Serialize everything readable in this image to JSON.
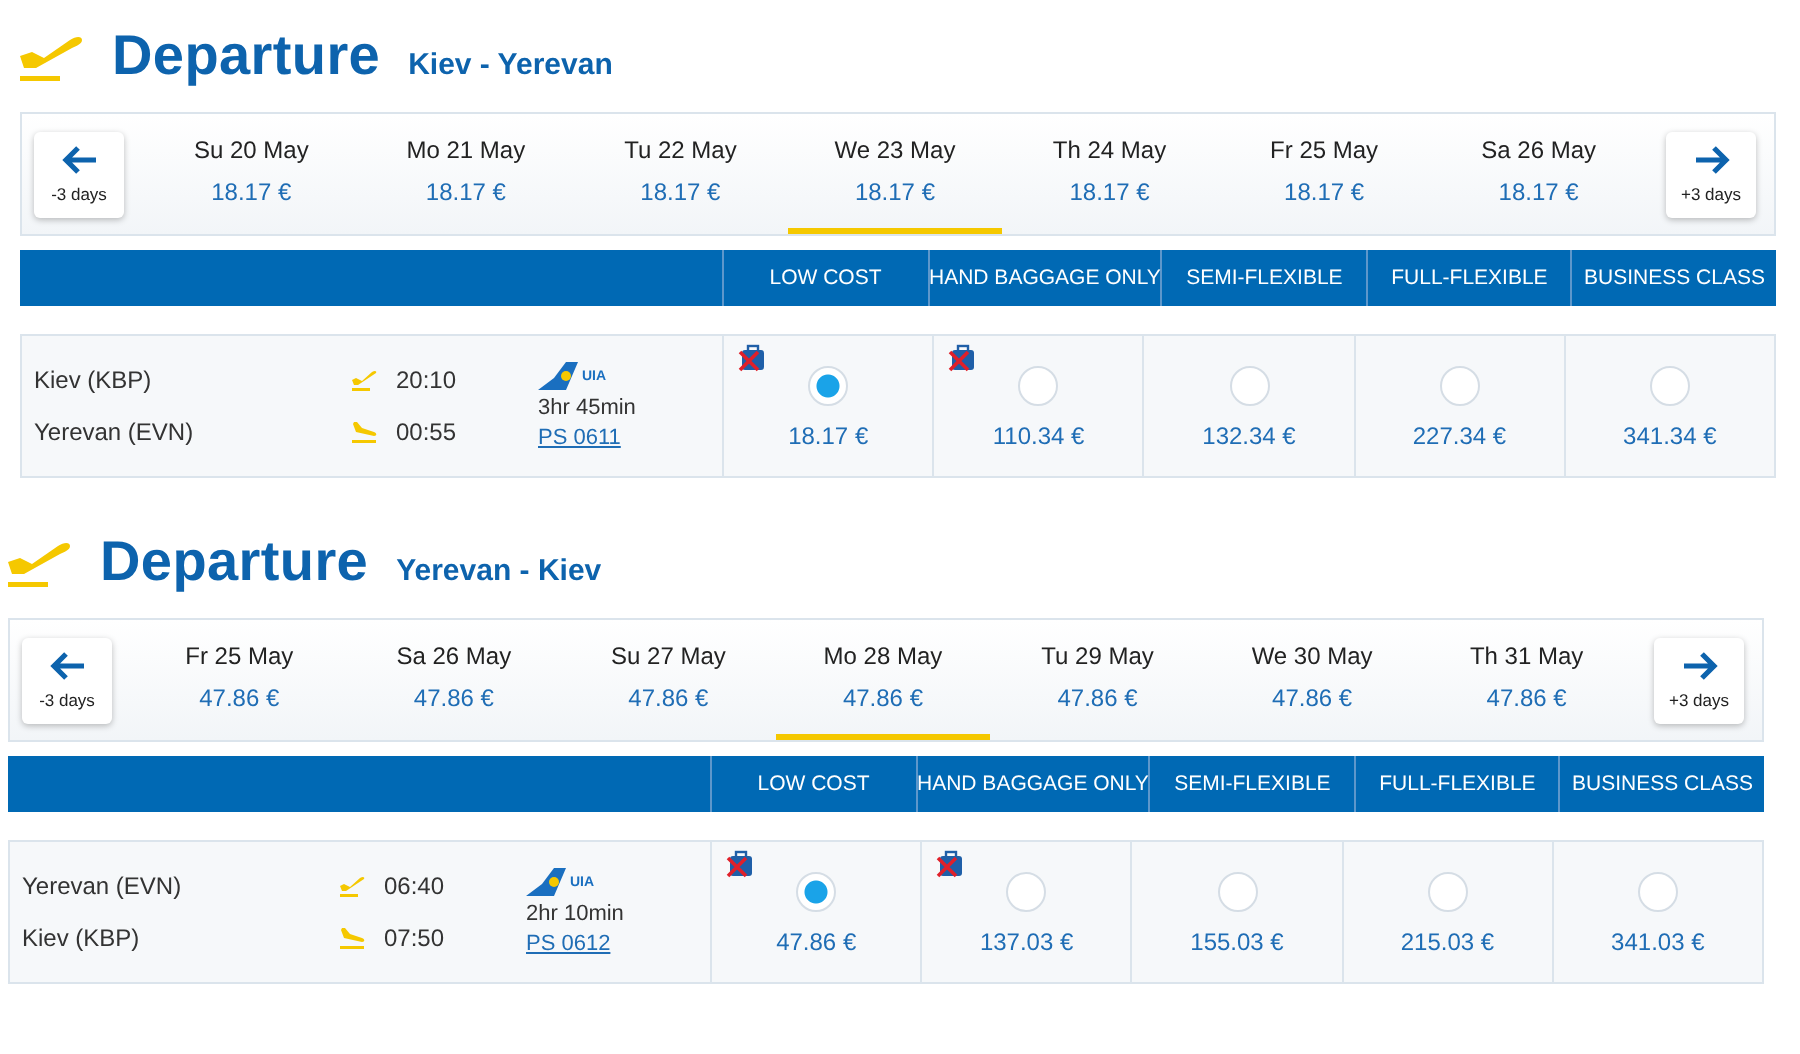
{
  "sections": [
    {
      "title": "Departure",
      "route": "Kiev - Yerevan",
      "prev": "-3 days",
      "next": "+3 days",
      "dates": [
        {
          "label": "Su 20 May",
          "price": "18.17 €",
          "selected": false
        },
        {
          "label": "Mo 21 May",
          "price": "18.17 €",
          "selected": false
        },
        {
          "label": "Tu 22 May",
          "price": "18.17 €",
          "selected": false
        },
        {
          "label": "We 23 May",
          "price": "18.17 €",
          "selected": true
        },
        {
          "label": "Th 24 May",
          "price": "18.17 €",
          "selected": false
        },
        {
          "label": "Fr 25 May",
          "price": "18.17 €",
          "selected": false
        },
        {
          "label": "Sa 26 May",
          "price": "18.17 €",
          "selected": false
        }
      ],
      "columns": [
        "LOW COST",
        "HAND BAGGAGE ONLY",
        "SEMI-FLEXIBLE",
        "FULL-FLEXIBLE",
        "BUSINESS CLASS"
      ],
      "flight": {
        "legs": [
          {
            "city": "Kiev (KBP)",
            "time": "20:10",
            "kind": "takeoff"
          },
          {
            "city": "Yerevan (EVN)",
            "time": "00:55",
            "kind": "landing"
          }
        ],
        "airline": "UIA",
        "duration": "3hr 45min",
        "number": "PS 0611"
      },
      "fares": [
        {
          "price": "18.17 €",
          "selected": true,
          "no_baggage": true
        },
        {
          "price": "110.34 €",
          "selected": false,
          "no_baggage": true
        },
        {
          "price": "132.34 €",
          "selected": false,
          "no_baggage": false
        },
        {
          "price": "227.34 €",
          "selected": false,
          "no_baggage": false
        },
        {
          "price": "341.34 €",
          "selected": false,
          "no_baggage": false
        }
      ]
    },
    {
      "title": "Departure",
      "route": "Yerevan - Kiev",
      "prev": "-3 days",
      "next": "+3 days",
      "dates": [
        {
          "label": "Fr 25 May",
          "price": "47.86 €",
          "selected": false
        },
        {
          "label": "Sa 26 May",
          "price": "47.86 €",
          "selected": false
        },
        {
          "label": "Su 27 May",
          "price": "47.86 €",
          "selected": false
        },
        {
          "label": "Mo 28 May",
          "price": "47.86 €",
          "selected": true
        },
        {
          "label": "Tu 29 May",
          "price": "47.86 €",
          "selected": false
        },
        {
          "label": "We 30 May",
          "price": "47.86 €",
          "selected": false
        },
        {
          "label": "Th 31 May",
          "price": "47.86 €",
          "selected": false
        }
      ],
      "columns": [
        "LOW COST",
        "HAND BAGGAGE ONLY",
        "SEMI-FLEXIBLE",
        "FULL-FLEXIBLE",
        "BUSINESS CLASS"
      ],
      "flight": {
        "legs": [
          {
            "city": "Yerevan (EVN)",
            "time": "06:40",
            "kind": "takeoff"
          },
          {
            "city": "Kiev (KBP)",
            "time": "07:50",
            "kind": "landing"
          }
        ],
        "airline": "UIA",
        "duration": "2hr 10min",
        "number": "PS 0612"
      },
      "fares": [
        {
          "price": "47.86 €",
          "selected": true,
          "no_baggage": true
        },
        {
          "price": "137.03 €",
          "selected": false,
          "no_baggage": true
        },
        {
          "price": "155.03 €",
          "selected": false,
          "no_baggage": false
        },
        {
          "price": "215.03 €",
          "selected": false,
          "no_baggage": false
        },
        {
          "price": "341.03 €",
          "selected": false,
          "no_baggage": false
        }
      ]
    }
  ]
}
